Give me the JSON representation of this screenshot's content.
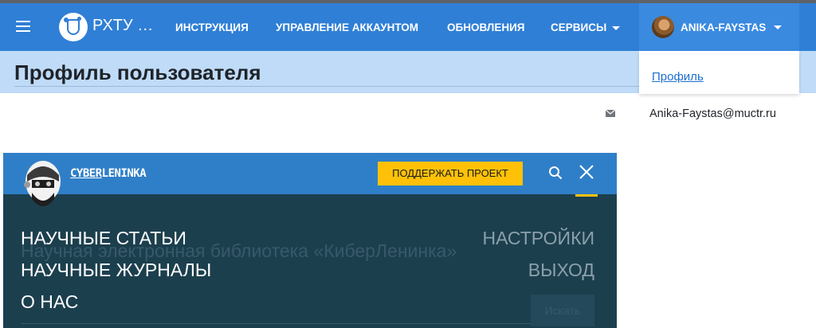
{
  "navbar": {
    "brand": "РХТУ …",
    "links": [
      "ИНСТРУКЦИЯ",
      "УПРАВЛЕНИЕ АККАУНТОМ",
      "ОБНОВЛЕНИЯ"
    ],
    "services_label": "СЕРВИСЫ",
    "user_name": "ANIKA-FAYSTAS"
  },
  "page": {
    "title": "Профиль пользователя",
    "email": "Anika-Faystas@muctr.ru"
  },
  "user_menu": {
    "items": [
      "Профиль"
    ]
  },
  "cyberleninka": {
    "logo_text_a": "CYBER",
    "logo_text_b": "LENINKA",
    "support_label": "ПОДДЕРЖАТЬ ПРОЕКТ",
    "menu": [
      "НАУЧНЫЕ СТАТЬИ",
      "НАУЧНЫЕ ЖУРНАЛЫ",
      "О НАС"
    ],
    "right_menu": [
      "НАСТРОЙКИ",
      "ВЫХОД"
    ],
    "background_text": "Научная электронная библиотека «КиберЛенинка»",
    "background_button": "Искать"
  },
  "colors": {
    "navbar": "#2f7fd6",
    "title_bar": "#bfdbf7",
    "cl_header": "#2f7fc8",
    "cl_overlay": "#1c3f4e",
    "cl_accent": "#ffc107"
  }
}
